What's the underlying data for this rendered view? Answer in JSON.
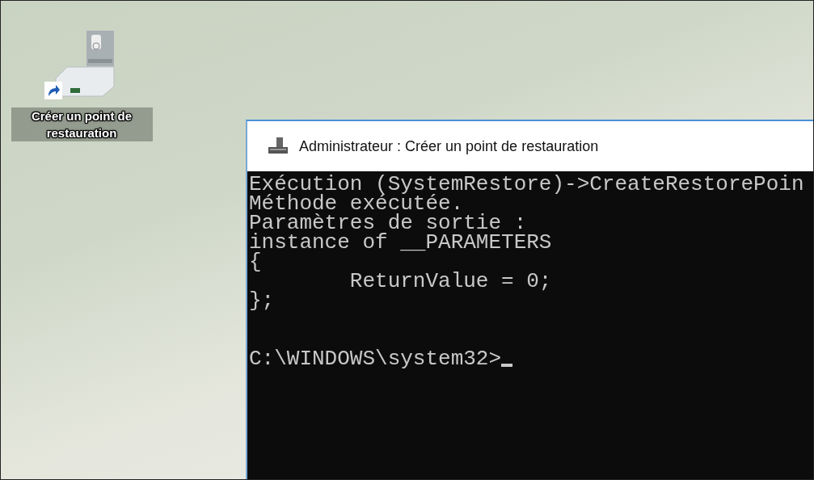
{
  "desktop": {
    "icons": [
      {
        "label": "Créer un point de restauration",
        "shortcut": true
      }
    ]
  },
  "console": {
    "title": "Administrateur : Créer un point de restauration",
    "output_lines": [
      "Exécution (SystemRestore)->CreateRestorePoin",
      "Méthode exécutée.",
      "Paramètres de sortie :",
      "instance of __PARAMETERS",
      "{",
      "        ReturnValue = 0;",
      "};"
    ],
    "prompt": "C:\\WINDOWS\\system32>",
    "cursor": true
  }
}
